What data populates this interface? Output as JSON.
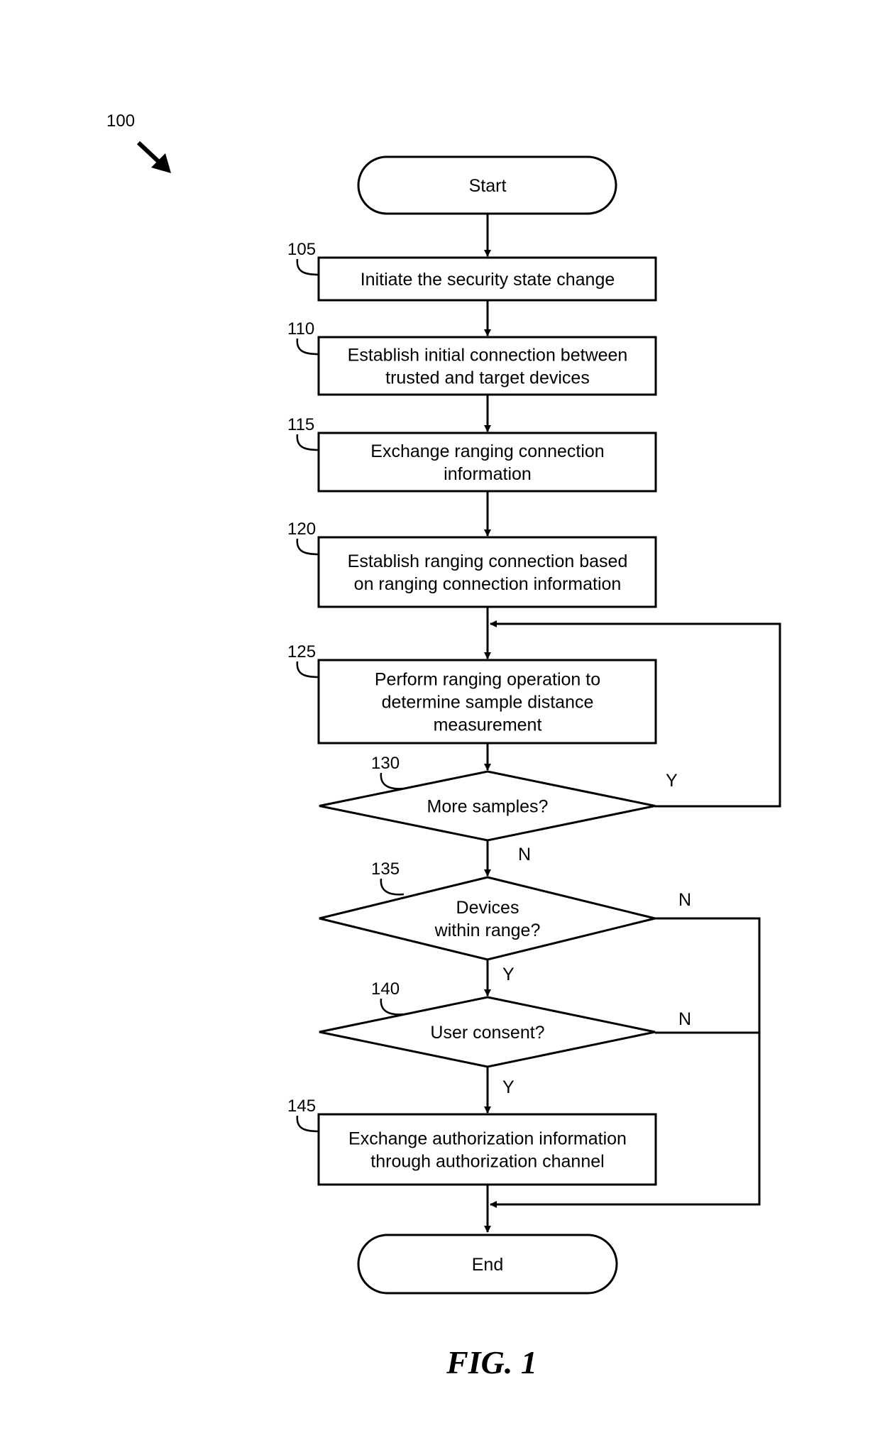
{
  "figure": {
    "ref_number": "100",
    "caption": "FIG. 1"
  },
  "start": {
    "label": "Start"
  },
  "end": {
    "label": "End"
  },
  "steps": [
    {
      "ref": "105",
      "lines": [
        "Initiate the security state change"
      ]
    },
    {
      "ref": "110",
      "lines": [
        "Establish initial connection between",
        "trusted and target devices"
      ]
    },
    {
      "ref": "115",
      "lines": [
        "Exchange ranging connection",
        "information"
      ]
    },
    {
      "ref": "120",
      "lines": [
        "Establish ranging connection based",
        "on ranging connection information"
      ]
    },
    {
      "ref": "125",
      "lines": [
        "Perform ranging operation to",
        "determine sample distance",
        "measurement"
      ]
    },
    {
      "ref": "145",
      "lines": [
        "Exchange authorization information",
        "through authorization channel"
      ]
    }
  ],
  "decisions": [
    {
      "ref": "130",
      "lines": [
        "More samples?"
      ],
      "yes": "Y",
      "no": "N"
    },
    {
      "ref": "135",
      "lines": [
        "Devices",
        "within range?"
      ],
      "yes": "Y",
      "no": "N"
    },
    {
      "ref": "140",
      "lines": [
        "User consent?"
      ],
      "yes": "Y",
      "no": "N"
    }
  ]
}
